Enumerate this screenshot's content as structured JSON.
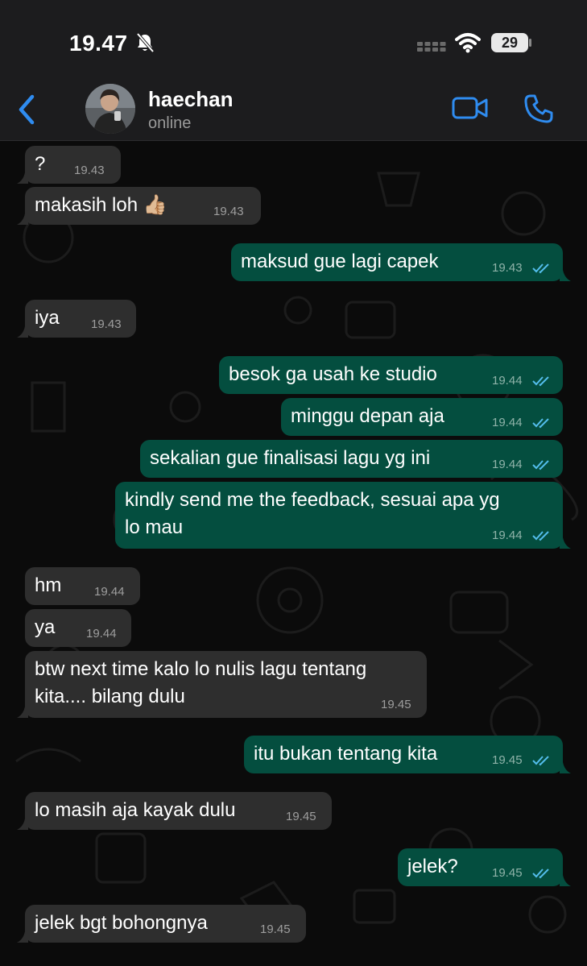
{
  "status_bar": {
    "time": "19.47",
    "battery": "29"
  },
  "header": {
    "contact_name": "haechan",
    "contact_status": "online"
  },
  "messages": [
    {
      "text": "?",
      "time": "19.43"
    },
    {
      "text": "makasih loh 👍🏼",
      "time": "19.43"
    },
    {
      "text": "maksud gue lagi capek",
      "time": "19.43"
    },
    {
      "text": "iya",
      "time": "19.43"
    },
    {
      "text": "besok ga usah ke studio",
      "time": "19.44"
    },
    {
      "text": "minggu depan aja",
      "time": "19.44"
    },
    {
      "text": "sekalian gue finalisasi lagu yg ini",
      "time": "19.44"
    },
    {
      "text": "kindly send me the feedback, sesuai apa yg\nlo mau",
      "time": "19.44"
    },
    {
      "text": "hm",
      "time": "19.44"
    },
    {
      "text": "ya",
      "time": "19.44"
    },
    {
      "text": "btw next time kalo lo nulis lagu tentang\nkita.... bilang dulu",
      "time": "19.45"
    },
    {
      "text": "itu bukan tentang kita",
      "time": "19.45"
    },
    {
      "text": "lo masih aja kayak dulu",
      "time": "19.45"
    },
    {
      "text": "jelek?",
      "time": "19.45"
    },
    {
      "text": "jelek bgt bohongnya",
      "time": "19.45"
    }
  ],
  "colors": {
    "accent": "#2f8cf0",
    "outgoing": "#044e3f",
    "incoming": "#2e2e2e",
    "read_ticks": "#53bdeb"
  },
  "icons": [
    "back-chevron-icon",
    "silent-bell-icon",
    "cell-signal-icon",
    "wifi-icon",
    "battery-icon",
    "video-call-icon",
    "phone-icon",
    "read-receipt-icon"
  ]
}
